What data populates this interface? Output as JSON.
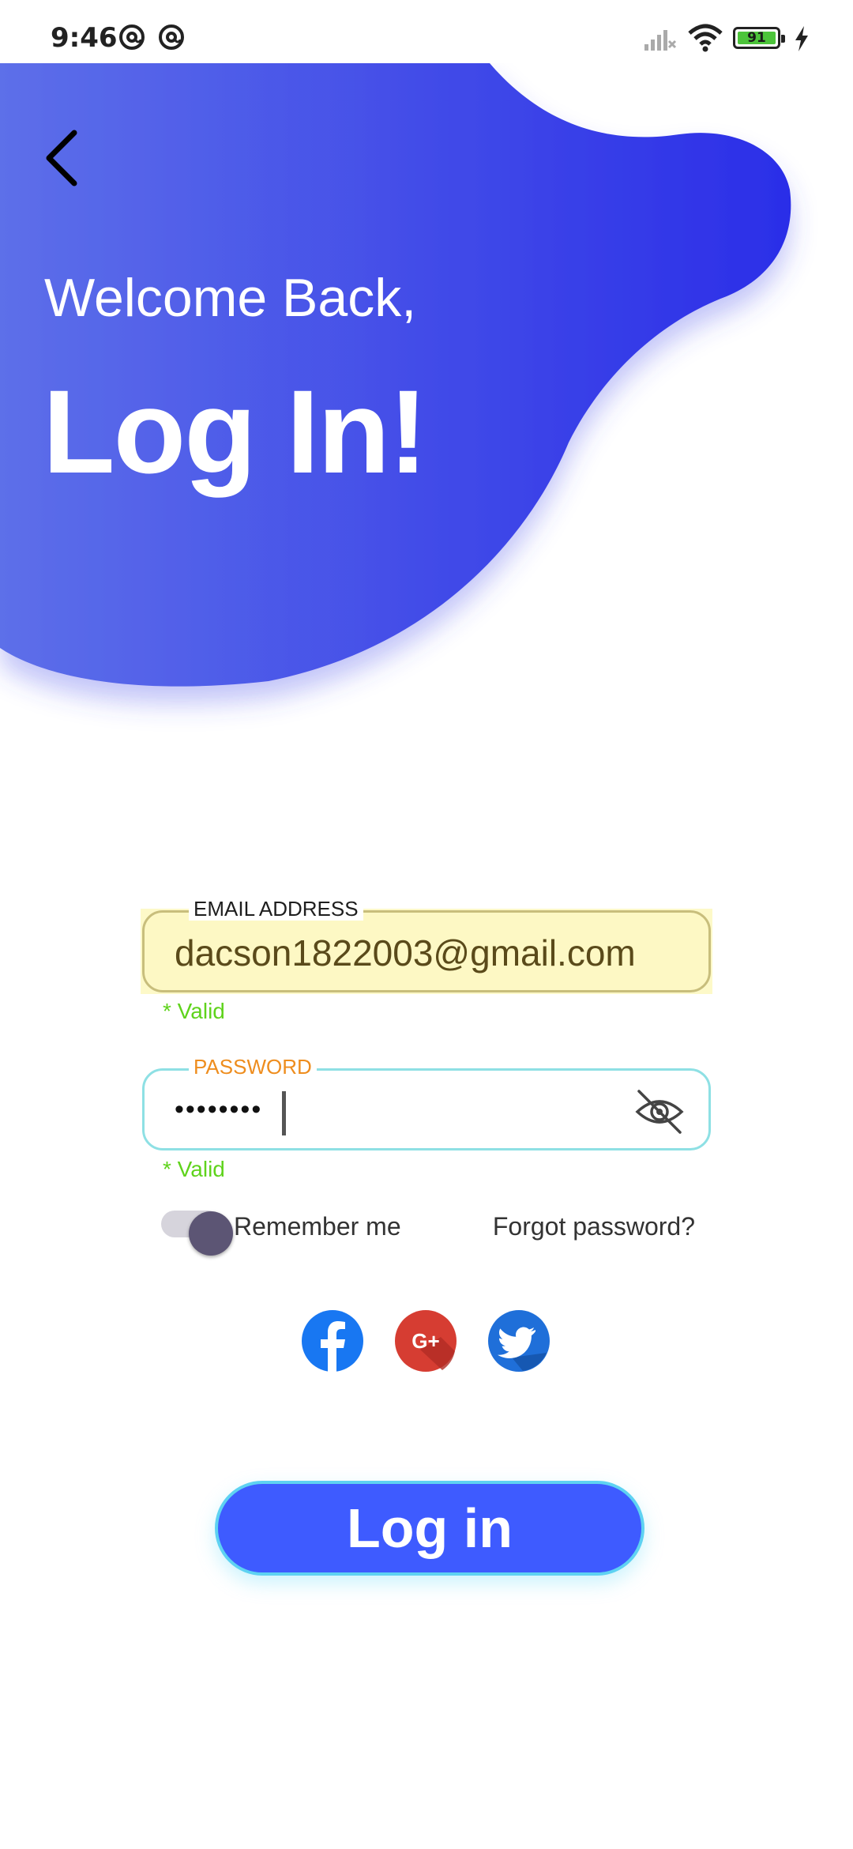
{
  "status_bar": {
    "time": "9:46",
    "battery_level": "91",
    "icons": [
      "at-sign-icon",
      "at-sign-icon",
      "signal-icon",
      "wifi-icon",
      "battery-icon",
      "charging-icon"
    ]
  },
  "header": {
    "greeting": "Welcome Back,",
    "title": "Log In!",
    "colors": {
      "gradient_start": "#5d6fe9",
      "gradient_end": "#2b2ee8"
    }
  },
  "form": {
    "email": {
      "label": "EMAIL ADDRESS",
      "value": "dacson1822003@gmail.com",
      "validation": "* Valid"
    },
    "password": {
      "label": "PASSWORD",
      "value": "••••••••",
      "validation": "* Valid"
    },
    "remember_label": "Remember me",
    "remember_enabled": true,
    "forgot_label": "Forgot password?"
  },
  "social": [
    "facebook-icon",
    "google-plus-icon",
    "twitter-icon"
  ],
  "login_button": {
    "label": "Log in",
    "color": "#3e5bff"
  }
}
